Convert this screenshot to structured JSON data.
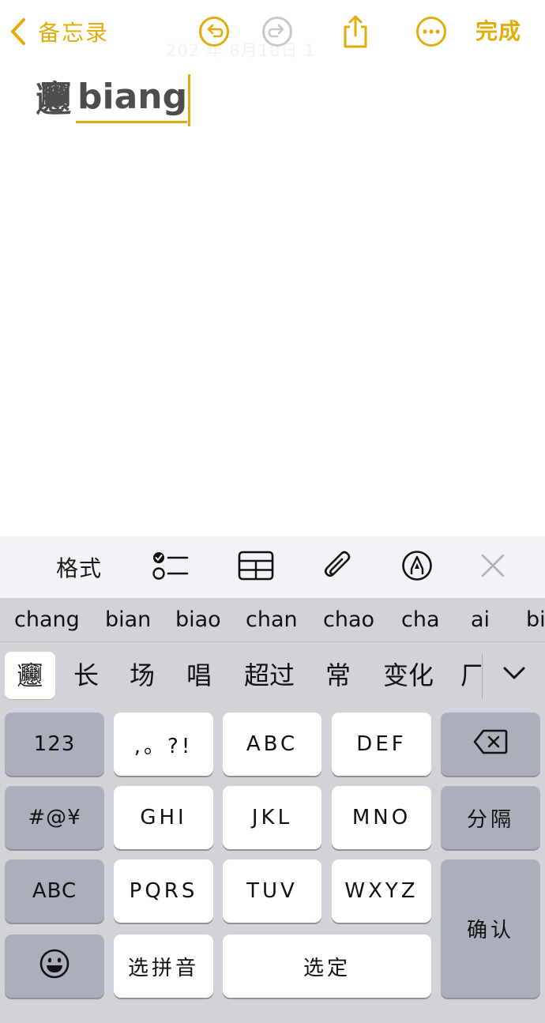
{
  "colors": {
    "accent": "#e3ac0d",
    "keyboard_bg": "#d1d3d9",
    "key_light": "#ffffff",
    "key_dark": "#abafb9",
    "toolbar_bg": "#f3f3f7"
  },
  "nav": {
    "back_label": "备忘录",
    "back_icon": "chevron-left-icon",
    "undo_icon": "undo-icon",
    "redo_icon": "redo-icon",
    "share_icon": "share-icon",
    "more_icon": "more-icon",
    "done_label": "完成",
    "faded_date": "202  年 8月18日  1"
  },
  "note": {
    "committed_text": "𰻞",
    "marked_text": "biang"
  },
  "format_toolbar": {
    "format_label": "格式",
    "checklist_icon": "checklist-icon",
    "table_icon": "table-icon",
    "attachment_icon": "paperclip-icon",
    "markup_icon": "markup-pen-icon",
    "close_icon": "close-icon"
  },
  "keyboard": {
    "pinyin_suggestions": [
      "chang",
      "bian",
      "biao",
      "chan",
      "chao",
      "cha",
      "ai",
      "bi"
    ],
    "candidates": [
      "𰻞",
      "长",
      "场",
      "唱",
      "超过",
      "常",
      "变化",
      "厂"
    ],
    "expand_icon": "chevron-down-icon",
    "keys": {
      "numbers": "123",
      "punct": ",。?!",
      "abc": "ABC",
      "def": "DEF",
      "delete_icon": "backspace-icon",
      "symbols": "#@¥",
      "ghi": "GHI",
      "jkl": "JKL",
      "mno": "MNO",
      "separator": "分隔",
      "abc_switch": "ABC",
      "pqrs": "PQRS",
      "tuv": "TUV",
      "wxyz": "WXYZ",
      "confirm": "确认",
      "emoji_icon": "emoji-icon",
      "select_pinyin": "选拼音",
      "select": "选定"
    }
  }
}
